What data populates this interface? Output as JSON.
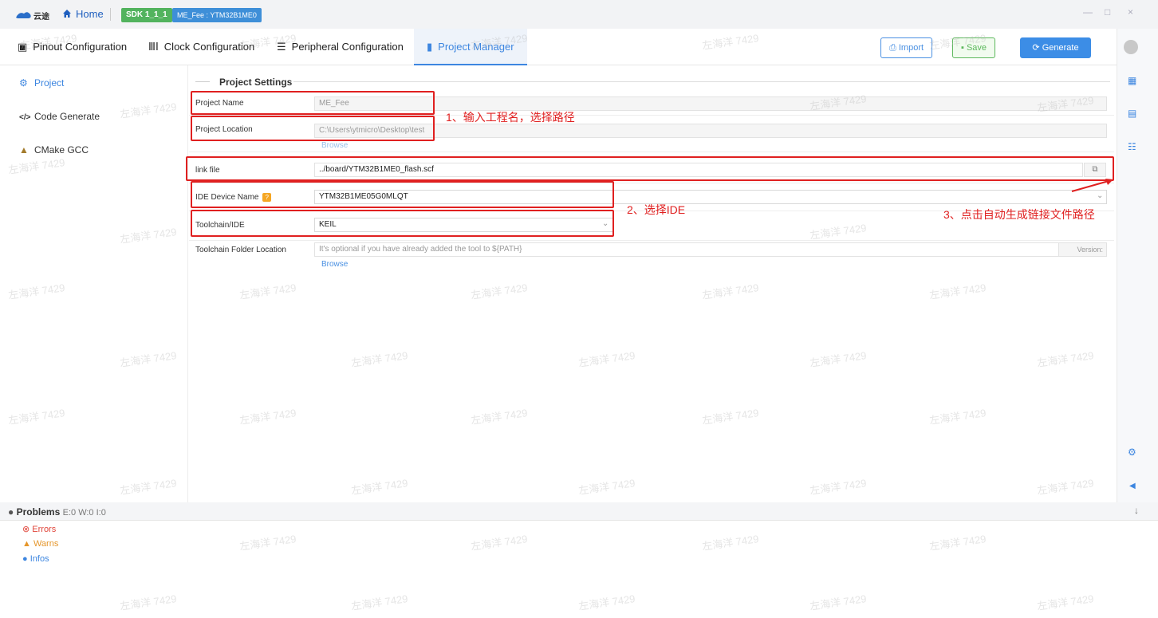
{
  "titlebar": {
    "logo_text": "云途",
    "home_label": "Home",
    "sdk_tag": "SDK 1_1_1",
    "project_tag": "ME_Fee : YTM32B1ME0",
    "window_controls": [
      "—",
      "□",
      "×"
    ]
  },
  "tabs": [
    {
      "label": "Pinout Configuration",
      "icon": "chip-icon"
    },
    {
      "label": "Clock Configuration",
      "icon": "clock-wave-icon"
    },
    {
      "label": "Peripheral Configuration",
      "icon": "peripheral-icon"
    },
    {
      "label": "Project Manager",
      "icon": "project-icon",
      "active": true
    }
  ],
  "toolbar": {
    "import_label": "Import",
    "save_label": "Save",
    "generate_label": "Generate"
  },
  "sidebar": {
    "items": [
      {
        "label": "Project",
        "icon": "gear-icon",
        "active": true
      },
      {
        "label": "Code Generate",
        "icon": "code-icon"
      },
      {
        "label": "CMake GCC",
        "icon": "cmake-icon"
      }
    ]
  },
  "project_settings": {
    "title": "Project Settings",
    "project_name_label": "Project Name",
    "project_name_value": "ME_Fee",
    "project_location_label": "Project Location",
    "project_location_value": "C:\\Users\\ytmicro\\Desktop\\test",
    "browse_label": "Browse",
    "link_file_label": "link file",
    "link_file_value": "../board/YTM32B1ME0_flash.scf",
    "ide_device_label": "IDE Device Name",
    "ide_device_value": "YTM32B1ME05G0MLQT",
    "toolchain_label": "Toolchain/IDE",
    "toolchain_value": "KEIL",
    "toolchain_folder_label": "Toolchain Folder Location",
    "toolchain_folder_placeholder": "It's optional if you have already added the tool to ${PATH}",
    "version_label": "Version:",
    "browse2_label": "Browse"
  },
  "annotations": {
    "step1": "1、输入工程名，选择路径",
    "step2": "2、选择IDE",
    "step3": "3、点击自动生成链接文件路径"
  },
  "problems": {
    "title": "Problems",
    "counts": "E:0 W:0 I:0",
    "errors_label": "Errors",
    "warns_label": "Warns",
    "infos_label": "Infos"
  },
  "watermark": "左海洋 7429",
  "colors": {
    "accent": "#3d86e0",
    "annotation_red": "#e02020",
    "save_green": "#5cb85c",
    "sdk_green": "#52b35e"
  }
}
